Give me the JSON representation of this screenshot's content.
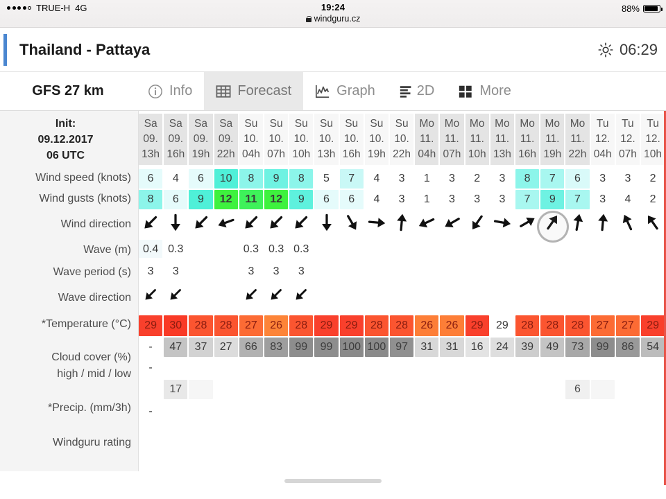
{
  "status_bar": {
    "carrier": "TRUE-H",
    "network": "4G",
    "time": "19:24",
    "url": "windguru.cz",
    "battery_percent": "88%",
    "lock_icon": "lock-icon",
    "signal_icon": "signal-dots-icon",
    "battery_icon": "battery-icon"
  },
  "header": {
    "title": "Thailand - Pattaya",
    "sunrise_icon": "sun-icon",
    "sunrise_time": "06:29",
    "accent_color": "#4a86d0"
  },
  "tabs": {
    "model_label": "GFS 27 km",
    "items": [
      {
        "label": "Info",
        "icon": "info-circle-icon",
        "active": false
      },
      {
        "label": "Forecast",
        "icon": "grid-icon",
        "active": true
      },
      {
        "label": "Graph",
        "icon": "chart-line-icon",
        "active": false
      },
      {
        "label": "2D",
        "icon": "bars-icon",
        "active": false
      },
      {
        "label": "More",
        "icon": "squares-icon",
        "active": false
      }
    ]
  },
  "init": {
    "line1": "Init:",
    "line2": "09.12.2017",
    "line3": "06 UTC"
  },
  "row_labels": {
    "wind_speed": "Wind speed (knots)",
    "wind_gusts": "Wind gusts (knots)",
    "wind_direction": "Wind direction",
    "wave": "Wave (m)",
    "wave_period": "Wave period (s)",
    "wave_direction": "Wave direction",
    "temperature": "*Temperature (°C)",
    "cloud_cover_1": "Cloud cover (%)",
    "cloud_cover_2": "high / mid / low",
    "precip": "*Precip. (mm/3h)",
    "rating": "Windguru rating"
  },
  "chart_data": {
    "type": "table",
    "title": "Thailand - Pattaya — GFS 27 km forecast",
    "columns": [
      {
        "day": "Sa",
        "date": "09.",
        "hour": "13h",
        "shaded": true
      },
      {
        "day": "Sa",
        "date": "09.",
        "hour": "16h",
        "shaded": true
      },
      {
        "day": "Sa",
        "date": "09.",
        "hour": "19h",
        "shaded": true
      },
      {
        "day": "Sa",
        "date": "09.",
        "hour": "22h",
        "shaded": true
      },
      {
        "day": "Su",
        "date": "10.",
        "hour": "04h",
        "shaded": false
      },
      {
        "day": "Su",
        "date": "10.",
        "hour": "07h",
        "shaded": false
      },
      {
        "day": "Su",
        "date": "10.",
        "hour": "10h",
        "shaded": false
      },
      {
        "day": "Su",
        "date": "10.",
        "hour": "13h",
        "shaded": false
      },
      {
        "day": "Su",
        "date": "10.",
        "hour": "16h",
        "shaded": false
      },
      {
        "day": "Su",
        "date": "10.",
        "hour": "19h",
        "shaded": false
      },
      {
        "day": "Su",
        "date": "10.",
        "hour": "22h",
        "shaded": false
      },
      {
        "day": "Mo",
        "date": "11.",
        "hour": "04h",
        "shaded": true
      },
      {
        "day": "Mo",
        "date": "11.",
        "hour": "07h",
        "shaded": true
      },
      {
        "day": "Mo",
        "date": "11.",
        "hour": "10h",
        "shaded": true
      },
      {
        "day": "Mo",
        "date": "11.",
        "hour": "13h",
        "shaded": true
      },
      {
        "day": "Mo",
        "date": "11.",
        "hour": "16h",
        "shaded": true
      },
      {
        "day": "Mo",
        "date": "11.",
        "hour": "19h",
        "shaded": true
      },
      {
        "day": "Mo",
        "date": "11.",
        "hour": "22h",
        "shaded": true
      },
      {
        "day": "Tu",
        "date": "12.",
        "hour": "04h",
        "shaded": false
      },
      {
        "day": "Tu",
        "date": "12.",
        "hour": "07h",
        "shaded": false
      },
      {
        "day": "Tu",
        "date": "12.",
        "hour": "10h",
        "shaded": false
      }
    ],
    "series": [
      {
        "name": "Wind speed (knots)",
        "values": [
          6,
          4,
          6,
          10,
          8,
          9,
          8,
          5,
          7,
          4,
          3,
          1,
          3,
          2,
          3,
          8,
          7,
          6,
          3,
          3,
          2
        ],
        "colors": [
          "#e5fbfb",
          "#ffffff",
          "#e5fbfb",
          "#4ff0d8",
          "#8cf5ea",
          "#6ef2e2",
          "#8cf5ea",
          "#ffffff",
          "#c9f8f6",
          "#ffffff",
          "#ffffff",
          "#ffffff",
          "#ffffff",
          "#ffffff",
          "#ffffff",
          "#8cf5ea",
          "#a8f7f0",
          "#d9faf9",
          "#ffffff",
          "#ffffff",
          "#ffffff"
        ],
        "bold": [
          false,
          false,
          false,
          false,
          false,
          false,
          false,
          false,
          false,
          false,
          false,
          false,
          false,
          false,
          false,
          false,
          false,
          false,
          false,
          false,
          false
        ]
      },
      {
        "name": "Wind gusts (knots)",
        "values": [
          8,
          6,
          9,
          12,
          11,
          12,
          9,
          6,
          6,
          4,
          3,
          1,
          3,
          3,
          3,
          7,
          9,
          7,
          3,
          4,
          2
        ],
        "colors": [
          "#8cf5ea",
          "#e5fbfb",
          "#4ff0d8",
          "#3ef23e",
          "#3ef25a",
          "#3ef23e",
          "#5ef1dd",
          "#e5fbfb",
          "#e5fbfb",
          "#ffffff",
          "#ffffff",
          "#ffffff",
          "#ffffff",
          "#ffffff",
          "#ffffff",
          "#a8f7f0",
          "#6ef2e2",
          "#a8f7f0",
          "#ffffff",
          "#ffffff",
          "#ffffff"
        ],
        "bold": [
          false,
          false,
          false,
          true,
          true,
          true,
          false,
          false,
          false,
          false,
          false,
          false,
          false,
          false,
          false,
          false,
          false,
          false,
          false,
          false,
          false
        ]
      },
      {
        "name": "Wind direction (degrees, arrow points where wind goes)",
        "values": [
          225,
          180,
          225,
          250,
          225,
          225,
          225,
          180,
          150,
          95,
          5,
          245,
          240,
          215,
          100,
          60,
          35,
          10,
          5,
          335,
          325
        ]
      },
      {
        "name": "Wave (m)",
        "values": [
          "0.4",
          "0.3",
          "",
          "",
          "0.3",
          "0.3",
          "0.3",
          "",
          "",
          "",
          "",
          "",
          "",
          "",
          "",
          "",
          "",
          "",
          "",
          "",
          ""
        ]
      },
      {
        "name": "Wave period (s)",
        "values": [
          "3",
          "3",
          "",
          "",
          "3",
          "3",
          "3",
          "",
          "",
          "",
          "",
          "",
          "",
          "",
          "",
          "",
          "",
          "",
          "",
          "",
          ""
        ]
      },
      {
        "name": "Wave direction (degrees)",
        "values": [
          225,
          225,
          null,
          null,
          225,
          225,
          225,
          null,
          null,
          null,
          null,
          null,
          null,
          null,
          null,
          null,
          null,
          null,
          null,
          null,
          null
        ]
      },
      {
        "name": "*Temperature (°C)",
        "values": [
          29,
          30,
          28,
          28,
          27,
          26,
          28,
          29,
          29,
          28,
          28,
          26,
          26,
          29,
          29,
          28,
          28,
          28,
          27,
          27,
          29
        ],
        "colors": [
          "#f9402c",
          "#f93a26",
          "#fb5530",
          "#fb5530",
          "#fc6b34",
          "#fd8438",
          "#fb5530",
          "#f9402c",
          "#f9402c",
          "#fb5530",
          "#fb5530",
          "#fd7e37",
          "#fd7e37",
          "#f9402c",
          "#ffffff",
          "#fb5530",
          "#fb5530",
          "#fb5530",
          "#fc6b34",
          "#fc6b34",
          "#f9402c"
        ]
      },
      {
        "name": "Cloud cover high (%)",
        "values": [
          "-",
          47,
          37,
          27,
          66,
          83,
          99,
          99,
          100,
          100,
          97,
          31,
          31,
          16,
          24,
          39,
          49,
          73,
          99,
          86,
          54
        ],
        "colors": [
          "#ffffff",
          "#c4c4c4",
          "#d2d2d2",
          "#dcdcdc",
          "#b1b1b1",
          "#9e9e9e",
          "#8d8d8d",
          "#8d8d8d",
          "#8a8a8a",
          "#8a8a8a",
          "#909090",
          "#d8d8d8",
          "#d8d8d8",
          "#e3e3e3",
          "#dedede",
          "#cdcdcd",
          "#c4c4c4",
          "#a8a8a8",
          "#8d8d8d",
          "#999999",
          "#bcbcbc"
        ]
      },
      {
        "name": "Cloud cover mid (%)",
        "values": [
          "-",
          "",
          "",
          "",
          "",
          "",
          "",
          "",
          "",
          "",
          "",
          "",
          "",
          "",
          "",
          "",
          "",
          "",
          "",
          "",
          ""
        ]
      },
      {
        "name": "Cloud cover low (%)",
        "values": [
          "",
          17,
          "",
          "",
          "",
          "",
          "",
          "",
          "",
          "",
          "",
          "",
          "",
          "",
          "",
          "",
          "",
          6,
          "",
          "",
          ""
        ],
        "colors": [
          "",
          "#e8e8e8",
          "#f6f6f6",
          "",
          "",
          "",
          "",
          "",
          "",
          "",
          "",
          "",
          "",
          "",
          "",
          "",
          "",
          "#f0f0f0",
          "#f6f6f6",
          "",
          ""
        ]
      },
      {
        "name": "*Precip. (mm/3h)",
        "values": [
          "-",
          "",
          "",
          "",
          "",
          "",
          "",
          "",
          "",
          "",
          "",
          "",
          "",
          "",
          "",
          "",
          "",
          "",
          "",
          "",
          ""
        ]
      },
      {
        "name": "Windguru rating",
        "values": [
          "",
          "",
          "",
          "",
          "",
          "",
          "",
          "",
          "",
          "",
          "",
          "",
          "",
          "",
          "",
          "",
          "",
          "",
          "",
          "",
          ""
        ]
      }
    ]
  },
  "touch_indicator": {
    "name": "touch-circle",
    "column_index": 16
  }
}
